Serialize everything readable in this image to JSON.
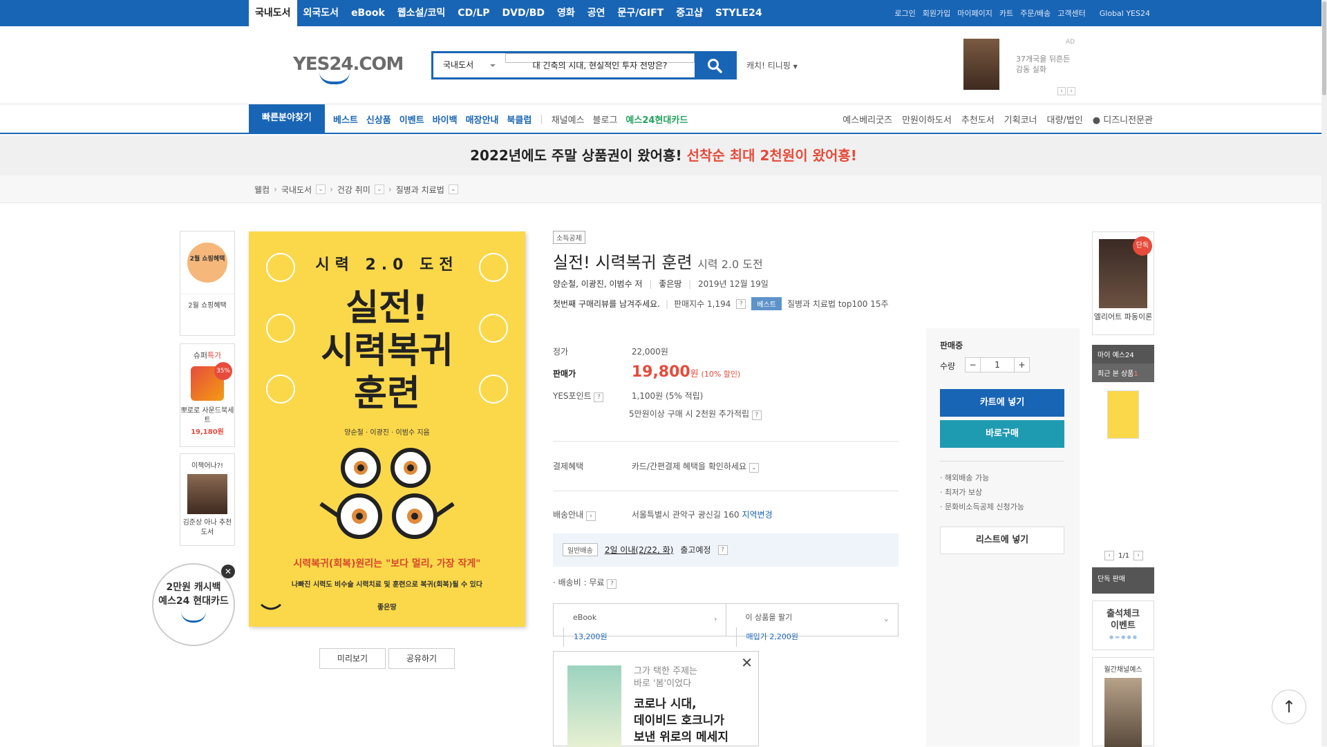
{
  "topbar": {
    "categories": [
      "국내도서",
      "외국도서",
      "eBook",
      "웹소설/코믹",
      "CD/LP",
      "DVD/BD",
      "영화",
      "공연",
      "문구/GIFT",
      "중고샵",
      "STYLE24"
    ],
    "util": [
      "로그인",
      "회원가입",
      "마이페이지",
      "카트",
      "주문/배송",
      "고객센터",
      "Global YES24"
    ]
  },
  "header": {
    "logo_text": "YES24.COM",
    "search_category": "국내도서",
    "search_query": "대 긴축의 시대, 현실적인 투자 전망은?",
    "catch_label": "캐치! 티니핑",
    "ad_label": "AD",
    "ad_text1": "37개국을 뒤흔든",
    "ad_text2": "감동 실화"
  },
  "gnb": {
    "quick": "빠른분야찾기",
    "left": [
      "베스트",
      "신상품",
      "이벤트",
      "바이백",
      "매장안내",
      "북클럽"
    ],
    "left_gray": [
      "채널예스",
      "블로그"
    ],
    "card": "예스24현대카드",
    "right": [
      "예스베리굿즈",
      "만원이하도서",
      "추천도서",
      "기획코너",
      "대량/법인",
      "디즈니전문관"
    ]
  },
  "banner": {
    "black": "2022년에도 주말 상품권이 왔어횽!",
    "red": "선착순 최대 2천원이 왔어횽!"
  },
  "breadcrumb": [
    "웰컴",
    "국내도서",
    "건강 취미",
    "질병과 치료법"
  ],
  "left_sidebar": {
    "box1_badge": "2월 쇼핑혜택",
    "box1_label": "2월 쇼핑혜택",
    "box2_title_a": "슈퍼",
    "box2_title_b": "특가",
    "box2_pct": "35%",
    "box2_name": "뽀로로 사운드북세트",
    "box2_price": "19,180원",
    "box3_title": "이책어나?!",
    "box3_name": "김준상 아나 추천도서",
    "circle_line1": "2만원 캐시백",
    "circle_line2": "예스24 현대카드"
  },
  "cover": {
    "top": "시력 2.0 도전",
    "title1": "실전!",
    "title2": "시력복귀",
    "title3": "훈련",
    "authors": "양순철 · 이광진 · 이범수 지음",
    "slogan": "시력복귀(회복)원리는 \"보다 멀리, 가장 작게\"",
    "sub": "나빠진 시력도 비수술 시력치료 및 훈련으로 복귀(회복)될 수 있다",
    "publisher": "좋은땅"
  },
  "buttons": {
    "preview": "미리보기",
    "share": "공유하기"
  },
  "product": {
    "tag": "소득공제",
    "title": "실전! 시력복귀 훈련",
    "subtitle": "시력 2.0 도전",
    "authors": "양순철, 이광진, 이범수 저",
    "publisher": "좋은땅",
    "date": "2019년 12월 19일",
    "review": "첫번째 구매리뷰를 남겨주세요.",
    "sales": "판매지수 1,194",
    "best_badge": "베스트",
    "best_rank": "질병과 치료법 top100 15주",
    "list_label": "정가",
    "list_price": "22,000원",
    "sale_label": "판매가",
    "sale_price": "19,800",
    "sale_unit": "원",
    "discount": "(10% 할인)",
    "point_label": "YES포인트",
    "point_value": "1,100원 (5% 적립)",
    "point_extra": "5만원이상 구매 시 2천원 추가적립",
    "pay_label": "결제혜택",
    "pay_value": "카드/간편결제 혜택을 확인하세요",
    "ship_label": "배송안내",
    "ship_addr": "서울특별시 관악구 광신길 160",
    "ship_change": "지역변경",
    "ship_badge": "일반배송",
    "ship_when": "2일 이내(2/22, 화)",
    "ship_out": "출고예정",
    "ship_fee": "· 배송비 : 무료",
    "ebook_label": "eBook",
    "ebook_price": "13,200원",
    "sell_label": "이 상품을 팔기",
    "sell_price": "매입가 2,200원"
  },
  "promo": {
    "line1": "그가 택한 주제는",
    "line2": "바로 '봄'이었다",
    "head1": "코로나 시대,",
    "head2": "데이비드 호크니가",
    "head3": "보낸 위로의 메세지"
  },
  "buybox": {
    "status": "판매중",
    "qty_label": "수량",
    "qty": "1",
    "cart": "카트에 넣기",
    "buynow": "바로구매",
    "bullets": [
      "해외배송 가능",
      "최저가 보상",
      "문화비소득공제 신청가능"
    ],
    "list": "리스트에 넣기"
  },
  "right_sidebar": {
    "badge": "단독",
    "book_name": "엘리어트 파동이론",
    "my": "마이 예스24",
    "recent": "최근 본 상품",
    "recent_count": "1",
    "pager": "1/1",
    "exclusive": "단독 판매",
    "attend1": "출석체크",
    "attend2": "이벤트",
    "channel": "월간채널예스"
  },
  "colors": {
    "brand": "#1965b5",
    "sale_red": "#e64b3b",
    "teal": "#1f9bb1"
  }
}
